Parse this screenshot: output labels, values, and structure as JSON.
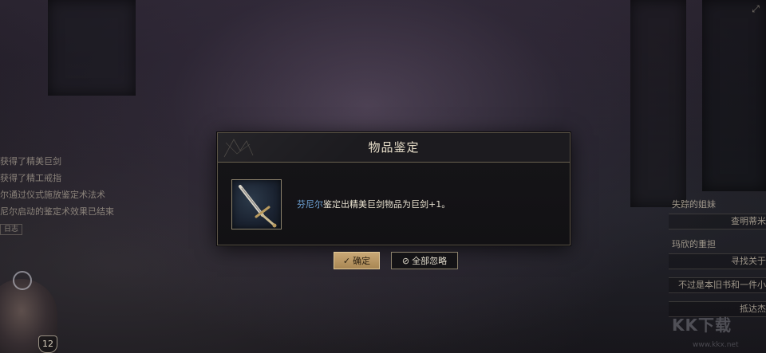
{
  "dialog": {
    "title": "物品鉴定",
    "message": {
      "actor": "芬尼尔",
      "text1": "鉴定出",
      "item": "精美巨剑",
      "text2": "物品为",
      "result": "巨剑",
      "suffix": "+1。"
    },
    "buttons": {
      "confirm_icon": "✓",
      "confirm_label": "确定",
      "ignore_icon": "⊘",
      "ignore_label": "全部忽略"
    }
  },
  "combat_log": {
    "lines": [
      "获得了精美巨剑",
      "获得了精工戒指",
      "尔通过仪式施放鉴定术法术",
      "尼尔启动的鉴定术效果已结束"
    ],
    "tag": "日志"
  },
  "quests": [
    {
      "title": "失踪的姐妹",
      "objective": "查明蒂米"
    },
    {
      "title": "玛欣的重担",
      "objective": "寻找关于"
    },
    {
      "title": "",
      "objective": "不过是本旧书和一件小"
    },
    {
      "title": "",
      "objective": "抵达杰"
    }
  ],
  "character": {
    "level": "12"
  },
  "watermark": {
    "text": "KK下载",
    "url": "www.kkx.net"
  },
  "icons": {
    "confirm": "checkmark-icon",
    "ignore": "cancel-circle-icon",
    "item": "greatsword-icon",
    "corner": "expand-icon"
  },
  "colors": {
    "accent_gold": "#c9a876",
    "actor_blue": "#6fa3d6",
    "text_light": "#e2dccd"
  }
}
